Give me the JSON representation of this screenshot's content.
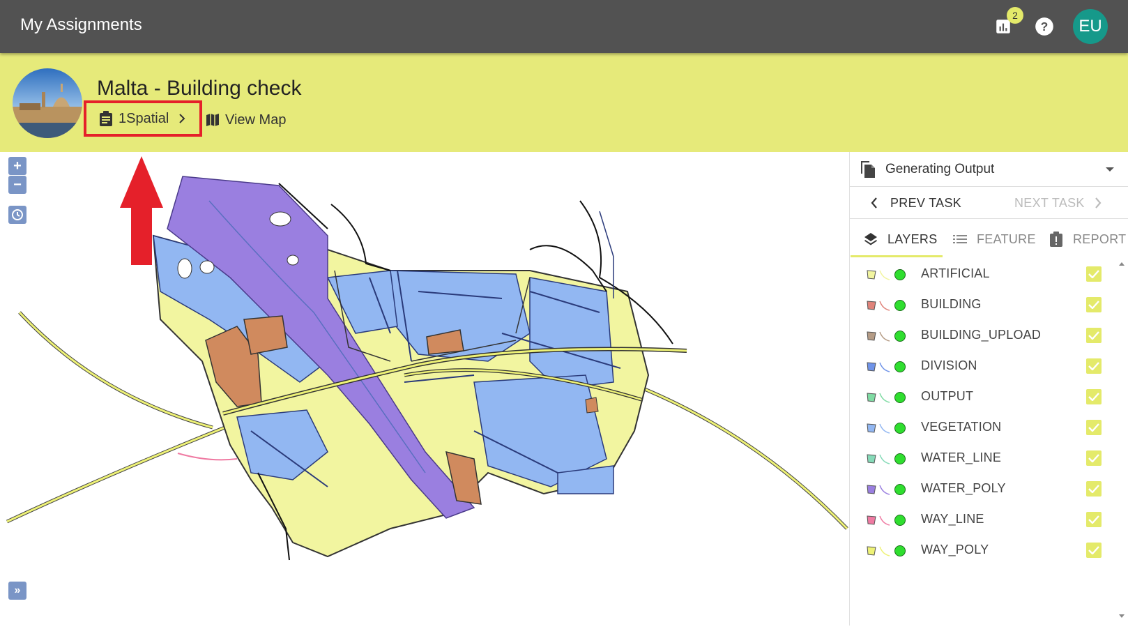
{
  "app": {
    "title": "My Assignments",
    "notification_count": "2",
    "user_initials": "EU",
    "icons": [
      "chart-icon",
      "help-icon"
    ],
    "accent_color": "#e4ea6a",
    "avatar_color": "#16998a"
  },
  "project": {
    "title": "Malta - Building check",
    "org_label": "1Spatial",
    "view_map_label": "View Map"
  },
  "map": {
    "zoom_in_label": "+",
    "zoom_out_label": "−",
    "expand_label": "»"
  },
  "sidebar": {
    "stage": "Generating Output",
    "prev_task": "PREV TASK",
    "next_task": "NEXT TASK",
    "tabs": {
      "layers": "LAYERS",
      "feature": "FEATURE",
      "report": "REPORT"
    },
    "layers": [
      {
        "name": "ARTIFICIAL",
        "color": "#f2f5a0",
        "checked": true
      },
      {
        "name": "BUILDING",
        "color": "#e0837a",
        "checked": true
      },
      {
        "name": "BUILDING_UPLOAD",
        "color": "#b59c86",
        "checked": true
      },
      {
        "name": "DIVISION",
        "color": "#6f93e8",
        "checked": true
      },
      {
        "name": "OUTPUT",
        "color": "#7fdba3",
        "checked": true
      },
      {
        "name": "VEGETATION",
        "color": "#92b7f2",
        "checked": true
      },
      {
        "name": "WATER_LINE",
        "color": "#86dab8",
        "checked": true
      },
      {
        "name": "WATER_POLY",
        "color": "#9a7fe0",
        "checked": true
      },
      {
        "name": "WAY_LINE",
        "color": "#ef7aa2",
        "checked": true
      },
      {
        "name": "WAY_POLY",
        "color": "#eef276",
        "checked": true
      }
    ]
  }
}
